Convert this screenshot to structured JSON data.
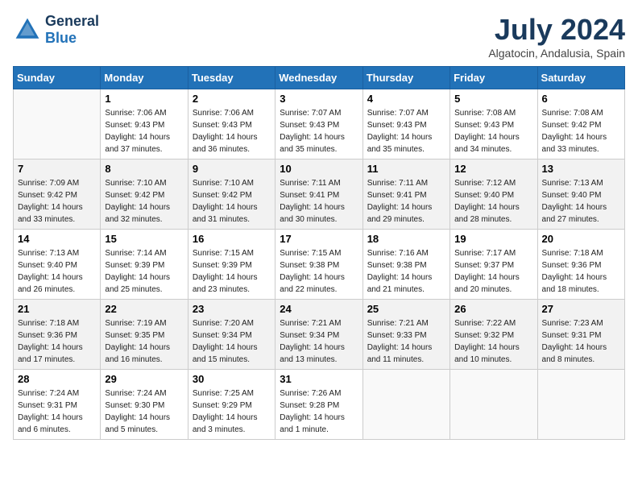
{
  "header": {
    "logo_line1": "General",
    "logo_line2": "Blue",
    "month_title": "July 2024",
    "location": "Algatocin, Andalusia, Spain"
  },
  "days_of_week": [
    "Sunday",
    "Monday",
    "Tuesday",
    "Wednesday",
    "Thursday",
    "Friday",
    "Saturday"
  ],
  "weeks": [
    [
      {
        "num": "",
        "info": ""
      },
      {
        "num": "1",
        "info": "Sunrise: 7:06 AM\nSunset: 9:43 PM\nDaylight: 14 hours\nand 37 minutes."
      },
      {
        "num": "2",
        "info": "Sunrise: 7:06 AM\nSunset: 9:43 PM\nDaylight: 14 hours\nand 36 minutes."
      },
      {
        "num": "3",
        "info": "Sunrise: 7:07 AM\nSunset: 9:43 PM\nDaylight: 14 hours\nand 35 minutes."
      },
      {
        "num": "4",
        "info": "Sunrise: 7:07 AM\nSunset: 9:43 PM\nDaylight: 14 hours\nand 35 minutes."
      },
      {
        "num": "5",
        "info": "Sunrise: 7:08 AM\nSunset: 9:43 PM\nDaylight: 14 hours\nand 34 minutes."
      },
      {
        "num": "6",
        "info": "Sunrise: 7:08 AM\nSunset: 9:42 PM\nDaylight: 14 hours\nand 33 minutes."
      }
    ],
    [
      {
        "num": "7",
        "info": "Sunrise: 7:09 AM\nSunset: 9:42 PM\nDaylight: 14 hours\nand 33 minutes."
      },
      {
        "num": "8",
        "info": "Sunrise: 7:10 AM\nSunset: 9:42 PM\nDaylight: 14 hours\nand 32 minutes."
      },
      {
        "num": "9",
        "info": "Sunrise: 7:10 AM\nSunset: 9:42 PM\nDaylight: 14 hours\nand 31 minutes."
      },
      {
        "num": "10",
        "info": "Sunrise: 7:11 AM\nSunset: 9:41 PM\nDaylight: 14 hours\nand 30 minutes."
      },
      {
        "num": "11",
        "info": "Sunrise: 7:11 AM\nSunset: 9:41 PM\nDaylight: 14 hours\nand 29 minutes."
      },
      {
        "num": "12",
        "info": "Sunrise: 7:12 AM\nSunset: 9:40 PM\nDaylight: 14 hours\nand 28 minutes."
      },
      {
        "num": "13",
        "info": "Sunrise: 7:13 AM\nSunset: 9:40 PM\nDaylight: 14 hours\nand 27 minutes."
      }
    ],
    [
      {
        "num": "14",
        "info": "Sunrise: 7:13 AM\nSunset: 9:40 PM\nDaylight: 14 hours\nand 26 minutes."
      },
      {
        "num": "15",
        "info": "Sunrise: 7:14 AM\nSunset: 9:39 PM\nDaylight: 14 hours\nand 25 minutes."
      },
      {
        "num": "16",
        "info": "Sunrise: 7:15 AM\nSunset: 9:39 PM\nDaylight: 14 hours\nand 23 minutes."
      },
      {
        "num": "17",
        "info": "Sunrise: 7:15 AM\nSunset: 9:38 PM\nDaylight: 14 hours\nand 22 minutes."
      },
      {
        "num": "18",
        "info": "Sunrise: 7:16 AM\nSunset: 9:38 PM\nDaylight: 14 hours\nand 21 minutes."
      },
      {
        "num": "19",
        "info": "Sunrise: 7:17 AM\nSunset: 9:37 PM\nDaylight: 14 hours\nand 20 minutes."
      },
      {
        "num": "20",
        "info": "Sunrise: 7:18 AM\nSunset: 9:36 PM\nDaylight: 14 hours\nand 18 minutes."
      }
    ],
    [
      {
        "num": "21",
        "info": "Sunrise: 7:18 AM\nSunset: 9:36 PM\nDaylight: 14 hours\nand 17 minutes."
      },
      {
        "num": "22",
        "info": "Sunrise: 7:19 AM\nSunset: 9:35 PM\nDaylight: 14 hours\nand 16 minutes."
      },
      {
        "num": "23",
        "info": "Sunrise: 7:20 AM\nSunset: 9:34 PM\nDaylight: 14 hours\nand 15 minutes."
      },
      {
        "num": "24",
        "info": "Sunrise: 7:21 AM\nSunset: 9:34 PM\nDaylight: 14 hours\nand 13 minutes."
      },
      {
        "num": "25",
        "info": "Sunrise: 7:21 AM\nSunset: 9:33 PM\nDaylight: 14 hours\nand 11 minutes."
      },
      {
        "num": "26",
        "info": "Sunrise: 7:22 AM\nSunset: 9:32 PM\nDaylight: 14 hours\nand 10 minutes."
      },
      {
        "num": "27",
        "info": "Sunrise: 7:23 AM\nSunset: 9:31 PM\nDaylight: 14 hours\nand 8 minutes."
      }
    ],
    [
      {
        "num": "28",
        "info": "Sunrise: 7:24 AM\nSunset: 9:31 PM\nDaylight: 14 hours\nand 6 minutes."
      },
      {
        "num": "29",
        "info": "Sunrise: 7:24 AM\nSunset: 9:30 PM\nDaylight: 14 hours\nand 5 minutes."
      },
      {
        "num": "30",
        "info": "Sunrise: 7:25 AM\nSunset: 9:29 PM\nDaylight: 14 hours\nand 3 minutes."
      },
      {
        "num": "31",
        "info": "Sunrise: 7:26 AM\nSunset: 9:28 PM\nDaylight: 14 hours\nand 1 minute."
      },
      {
        "num": "",
        "info": ""
      },
      {
        "num": "",
        "info": ""
      },
      {
        "num": "",
        "info": ""
      }
    ]
  ]
}
